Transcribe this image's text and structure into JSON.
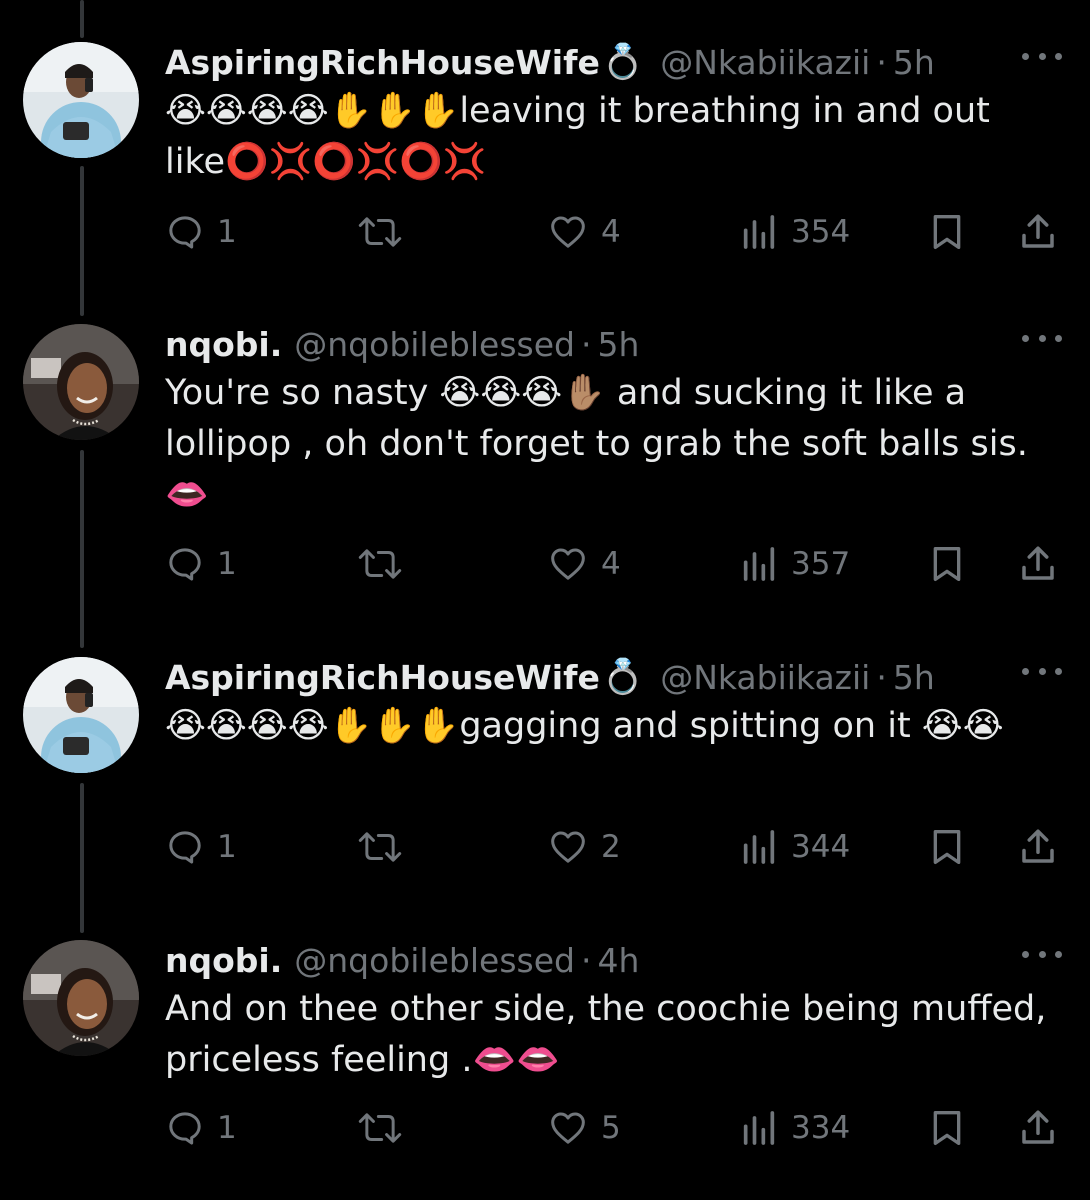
{
  "tweets": [
    {
      "author": "AspiringRichHouseWife",
      "verified_glyph": "💍",
      "handle": "@Nkabiikazii",
      "sep": "·",
      "time": "5h",
      "text": "😭😭😭😭✋✋✋leaving it breathing in and out like⭕💢⭕💢⭕💢",
      "replies": "1",
      "likes": "4",
      "views": "354",
      "avatar": "avatar-woman-blue"
    },
    {
      "author": "nqobi.",
      "handle": "@nqobileblessed",
      "sep": "·",
      "time": "5h",
      "text": "You're so nasty 😭😭😭✋🏽  and sucking it like a lollipop , oh don't forget to grab the soft balls sis. 👄",
      "replies": "1",
      "likes": "4",
      "views": "357",
      "avatar": "avatar-woman-car"
    },
    {
      "author": "AspiringRichHouseWife",
      "verified_glyph": "💍",
      "handle": "@Nkabiikazii",
      "sep": "·",
      "time": "5h",
      "text": "😭😭😭😭✋✋✋gagging and spitting on it 😭😭",
      "replies": "1",
      "likes": "2",
      "views": "344",
      "avatar": "avatar-woman-blue"
    },
    {
      "author": "nqobi.",
      "handle": "@nqobileblessed",
      "sep": "·",
      "time": "4h",
      "text": "And on thee other side,  the coochie being muffed,  priceless feeling .👄👄",
      "replies": "1",
      "likes": "5",
      "views": "334",
      "avatar": "avatar-woman-car"
    }
  ],
  "icons": {
    "reply": "reply-icon",
    "retweet": "retweet-icon",
    "like": "heart-icon",
    "views": "views-icon",
    "bookmark": "bookmark-icon",
    "share": "share-icon",
    "more": "more-icon"
  },
  "colors": {
    "background": "#000000",
    "text": "#e7e9ea",
    "muted": "#71767b",
    "thread_line": "#333639"
  }
}
